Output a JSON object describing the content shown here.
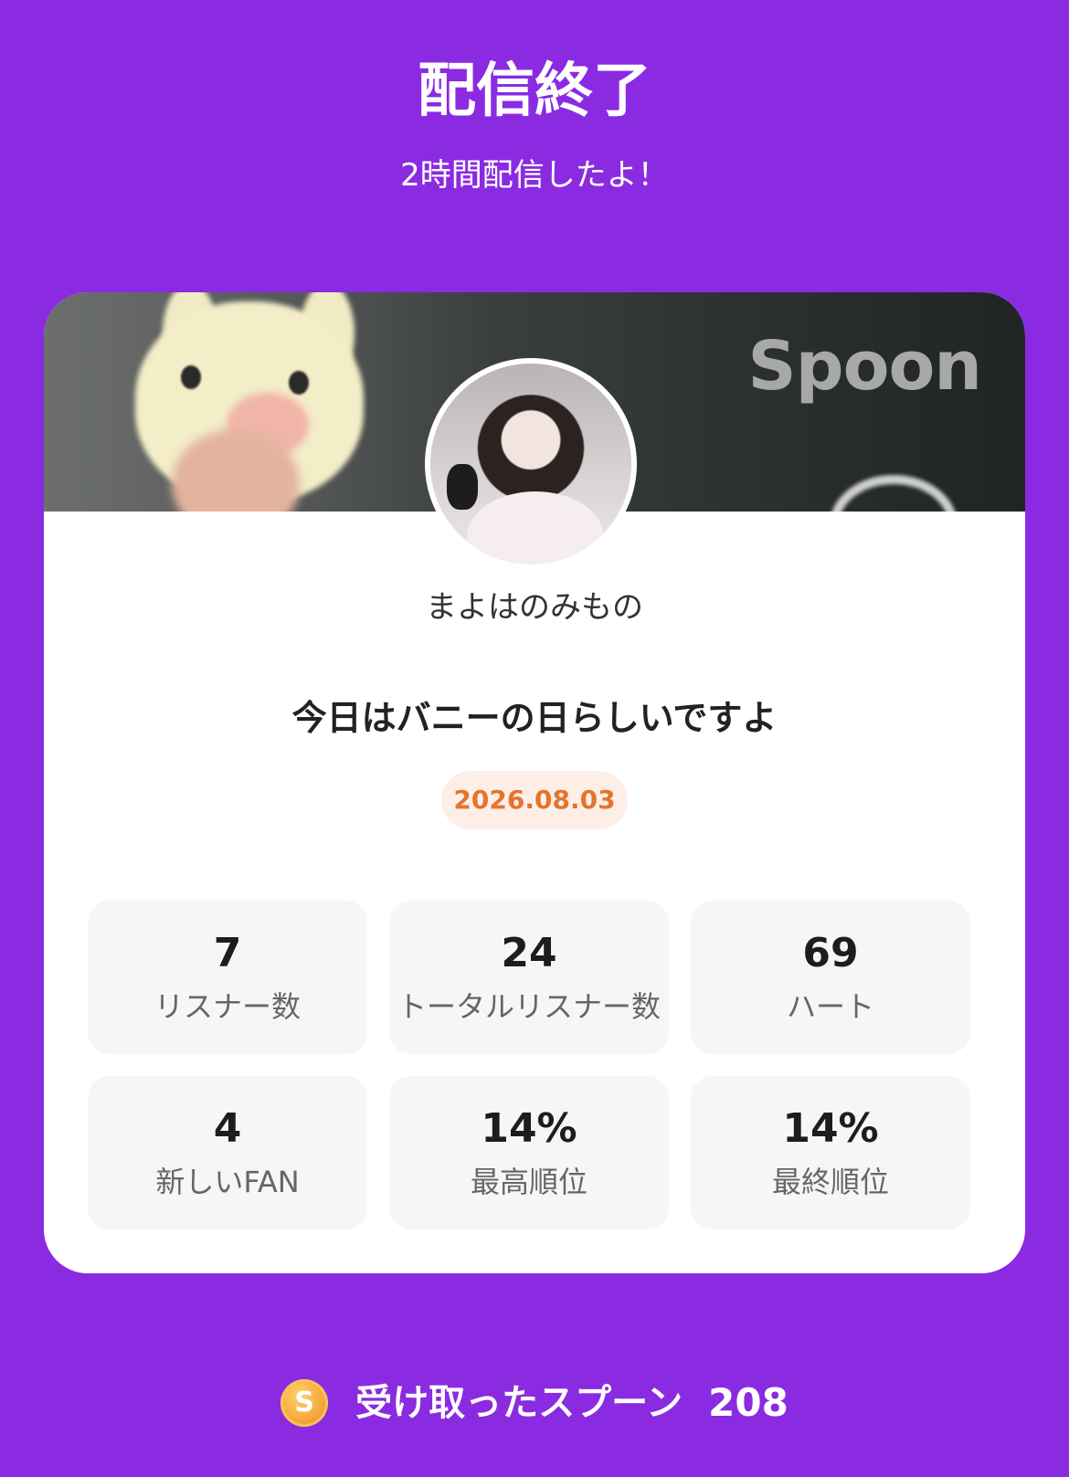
{
  "header": {
    "title": "配信終了",
    "subtitle": "2時間配信したよ！"
  },
  "card": {
    "brand": "Spoon",
    "username": "まよはのみもの",
    "stream_title": "今日はバニーの日らしいですよ",
    "date": "2026.08.03",
    "stats": [
      {
        "value": "7",
        "label": "リスナー数"
      },
      {
        "value": "24",
        "label": "トータルリスナー数"
      },
      {
        "value": "69",
        "label": "ハート"
      },
      {
        "value": "4",
        "label": "新しいFAN"
      },
      {
        "value": "14%",
        "label": "最高順位"
      },
      {
        "value": "14%",
        "label": "最終順位"
      }
    ]
  },
  "footer": {
    "coin_letter": "S",
    "label": "受け取ったスプーン",
    "value": "208"
  },
  "colors": {
    "background": "#8a2be2",
    "date_accent": "#e4742e",
    "coin": "#f6a53a"
  },
  "icons": {
    "coin": "spoon-coin-icon"
  }
}
